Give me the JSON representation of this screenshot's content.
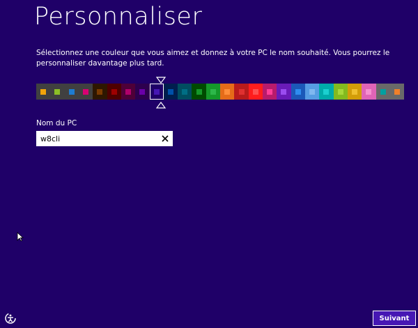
{
  "page": {
    "title": "Personnaliser",
    "description": "Sélectionnez une couleur que vous aimez et donnez à votre PC le nom souhaité. Vous pourrez le personnaliser davantage plus tard.",
    "background_color": "#1f0068"
  },
  "color_picker": {
    "selected_index": 8,
    "swatches": [
      {
        "bg": "#404040",
        "dot": "#f0a30a"
      },
      {
        "bg": "#404040",
        "dot": "#8cbf26"
      },
      {
        "bg": "#404040",
        "dot": "#1e7cd0"
      },
      {
        "bg": "#404040",
        "dot": "#d80073"
      },
      {
        "bg": "#2e1700",
        "dot": "#7b3a00"
      },
      {
        "bg": "#4e0000",
        "dot": "#9e0000"
      },
      {
        "bg": "#4e0038",
        "dot": "#b0006b"
      },
      {
        "bg": "#2d004e",
        "dot": "#6a00a8"
      },
      {
        "bg": "#1f0068",
        "dot": "#4617b4"
      },
      {
        "bg": "#001e4e",
        "dot": "#0050a8"
      },
      {
        "bg": "#004d60",
        "dot": "#006e85"
      },
      {
        "bg": "#004a00",
        "dot": "#15992a"
      },
      {
        "bg": "#15992a",
        "dot": "#2db84a"
      },
      {
        "bg": "#e56c19",
        "dot": "#ff8f3a"
      },
      {
        "bg": "#b81b1b",
        "dot": "#e03030"
      },
      {
        "bg": "#ff1d1d",
        "dot": "#ff5050"
      },
      {
        "bg": "#b81b6c",
        "dot": "#ff3d9a"
      },
      {
        "bg": "#691bb8",
        "dot": "#9a4cf0"
      },
      {
        "bg": "#1b58b8",
        "dot": "#2e8df0"
      },
      {
        "bg": "#569ce3",
        "dot": "#80b8f0"
      },
      {
        "bg": "#00aaaa",
        "dot": "#1ad0d0"
      },
      {
        "bg": "#83ba1f",
        "dot": "#a6d83a"
      },
      {
        "bg": "#d39d09",
        "dot": "#f0c030"
      },
      {
        "bg": "#e064b7",
        "dot": "#f590d0"
      },
      {
        "bg": "#696969",
        "dot": "#00a0a0"
      },
      {
        "bg": "#696969",
        "dot": "#f0802a"
      }
    ]
  },
  "pc_name": {
    "label": "Nom du PC",
    "value": "w8cli"
  },
  "footer": {
    "next_label": "Suivant"
  },
  "icons": {
    "clear": "close-icon",
    "ease_of_access": "ease-of-access-icon",
    "cursor": "mouse-cursor-icon"
  }
}
